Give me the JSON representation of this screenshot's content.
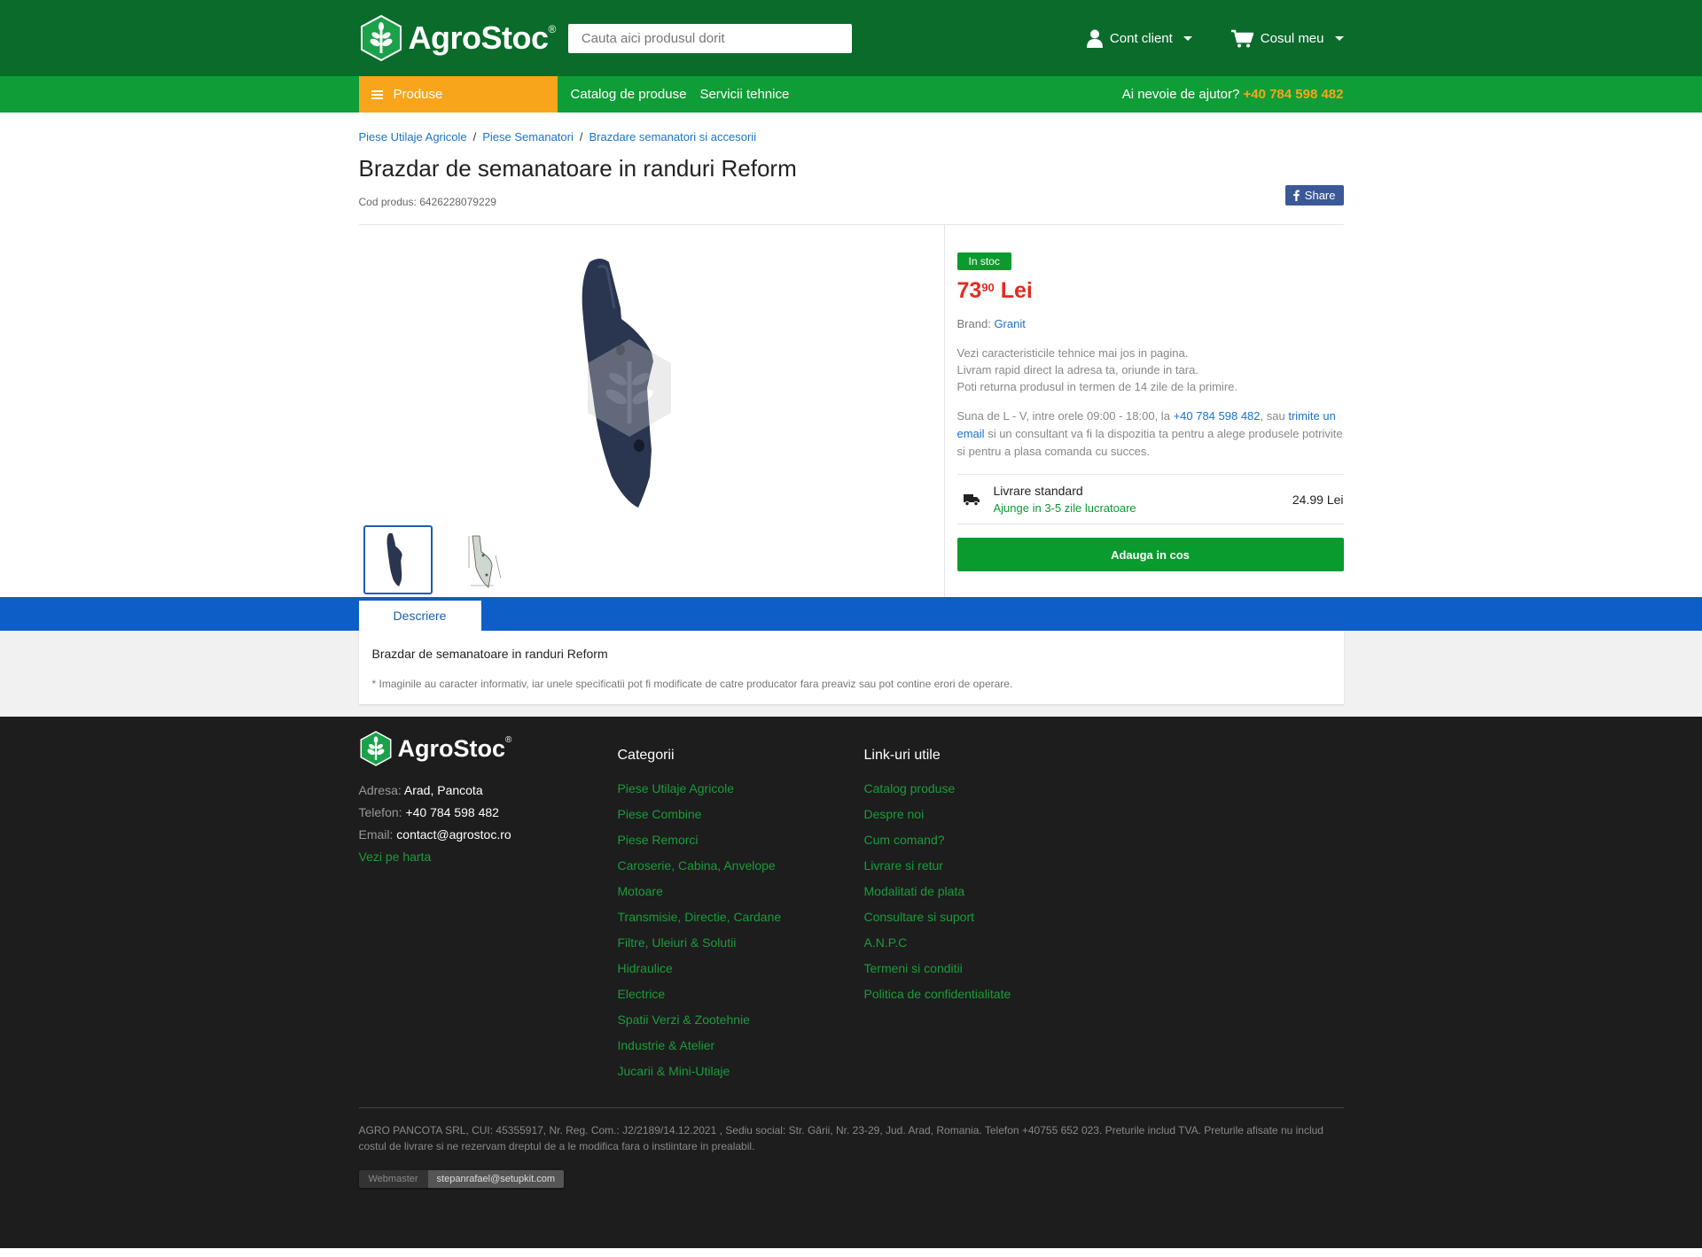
{
  "header": {
    "brand": "AgroStoc",
    "reg_mark": "®",
    "search_placeholder": "Cauta aici produsul dorit",
    "account_label": "Cont client",
    "cart_label": "Cosul meu"
  },
  "nav": {
    "products_label": "Produse",
    "items": [
      {
        "label": "Catalog de produse"
      },
      {
        "label": "Servicii tehnice"
      }
    ],
    "help_text": "Ai nevoie de ajutor?",
    "help_phone": "+40 784 598 482"
  },
  "breadcrumb": [
    {
      "label": "Piese Utilaje Agricole"
    },
    {
      "label": "Piese Semanatori"
    },
    {
      "label": "Brazdare semanatori si accesorii"
    }
  ],
  "product": {
    "title": "Brazdar de semanatoare in randuri Reform",
    "code": "Cod produs: 6426228079229",
    "share_label": "Share",
    "stock": "In stoc",
    "price_int": "73",
    "price_dec": "90",
    "currency": "Lei",
    "brand_label": "Brand:",
    "brand_value": "Granit",
    "desc_lines": [
      "Vezi caracteristicile tehnice mai jos in pagina.",
      "Livram rapid direct la adresa ta, oriunde in tara.",
      "Poti returna produsul in termen de 14 zile de la primire."
    ],
    "contact_pre": "Suna de L - V, intre orele 09:00 - 18:00, la",
    "contact_phone": "+40 784 598 482",
    "contact_mid": ", sau",
    "contact_email_link": "trimite un email",
    "contact_post": "si un consultant va fi la dispozitia ta pentru a alege produsele potrivite si pentru a plasa comanda cu succes.",
    "delivery_title": "Livrare standard",
    "delivery_sub": "Ajunge in 3-5 zile lucratoare",
    "delivery_price": "24.99 Lei",
    "add_to_cart": "Adauga in cos"
  },
  "tabs": {
    "active": "Descriere",
    "content_title": "Brazdar de semanatoare in randuri Reform",
    "note": "* Imaginile au caracter informativ, iar unele specificatii pot fi modificate de catre producator fara preaviz sau pot contine erori de operare."
  },
  "footer": {
    "address_label": "Adresa:",
    "address": "Arad, Pancota",
    "phone_label": "Telefon:",
    "phone": "+40 784 598 482",
    "email_label": "Email:",
    "email": "contact@agrostoc.ro",
    "map_link": "Vezi pe harta",
    "categories_title": "Categorii",
    "categories": [
      "Piese Utilaje Agricole",
      "Piese Combine",
      "Piese Remorci",
      "Caroserie, Cabina, Anvelope",
      "Motoare",
      "Transmisie, Directie, Cardane",
      "Filtre, Uleiuri & Solutii",
      "Hidraulice",
      "Electrice",
      "Spatii Verzi & Zootehnie",
      "Industrie & Atelier",
      "Jucarii & Mini-Utilaje"
    ],
    "links_title": "Link-uri utile",
    "links": [
      "Catalog produse",
      "Despre noi",
      "Cum comand?",
      "Livrare si retur",
      "Modalitati de plata",
      "Consultare si suport",
      "A.N.P.C",
      "Termeni si conditii",
      "Politica de confidentialitate"
    ],
    "legal": "AGRO PANCOTA SRL, CUI: 45355917, Nr. Reg. Com.: J2/2189/14.12.2021 , Sediu social: Str. Gării, Nr. 23-29, Jud. Arad, Romania. Telefon +40755 652 023. Preturile includ TVA. Preturile afisate nu includ costul de livrare si ne rezervam dreptul de a le modifica fara o instiintare in prealabil.",
    "webmaster_label": "Webmaster",
    "webmaster_value": "stepanrafael@setupkit.com"
  },
  "colors": {
    "header": "#0a6b2b",
    "nav": "#0f9d37",
    "accent": "#f9a51b",
    "price": "#e32b1f",
    "tabbar": "#0d5fc7",
    "footer": "#1d1d1d"
  }
}
